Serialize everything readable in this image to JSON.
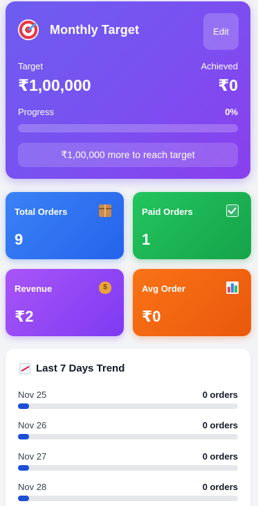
{
  "target": {
    "title": "Monthly Target",
    "edit_label": "Edit",
    "target_label": "Target",
    "achieved_label": "Achieved",
    "target_value": "₹1,00,000",
    "achieved_value": "₹0",
    "progress_label": "Progress",
    "progress_percent": "0%",
    "progress_fraction": 0,
    "remaining_text": "₹1,00,000 more to reach target"
  },
  "stats": {
    "total_orders": {
      "label": "Total Orders",
      "value": "9",
      "icon": "package-icon"
    },
    "paid_orders": {
      "label": "Paid Orders",
      "value": "1",
      "icon": "check-icon"
    },
    "revenue": {
      "label": "Revenue",
      "value": "₹2",
      "icon": "money-bag-icon"
    },
    "avg_order": {
      "label": "Avg Order",
      "value": "₹0",
      "icon": "bar-chart-icon"
    }
  },
  "trend": {
    "title": "Last 7 Days Trend",
    "icon": "chart-increasing-icon",
    "rows": [
      {
        "date": "Nov 25",
        "count": "0 orders"
      },
      {
        "date": "Nov 26",
        "count": "0 orders"
      },
      {
        "date": "Nov 27",
        "count": "0 orders"
      },
      {
        "date": "Nov 28",
        "count": "0 orders"
      }
    ]
  },
  "colors": {
    "target_gradient_start": "#6d5df0",
    "target_gradient_end": "#8a3fee",
    "total_orders": "#3b82f6",
    "paid_orders": "#22c55e",
    "revenue": "#a855f7",
    "avg_order": "#f97316",
    "trend_bar": "#1d4ed8"
  }
}
